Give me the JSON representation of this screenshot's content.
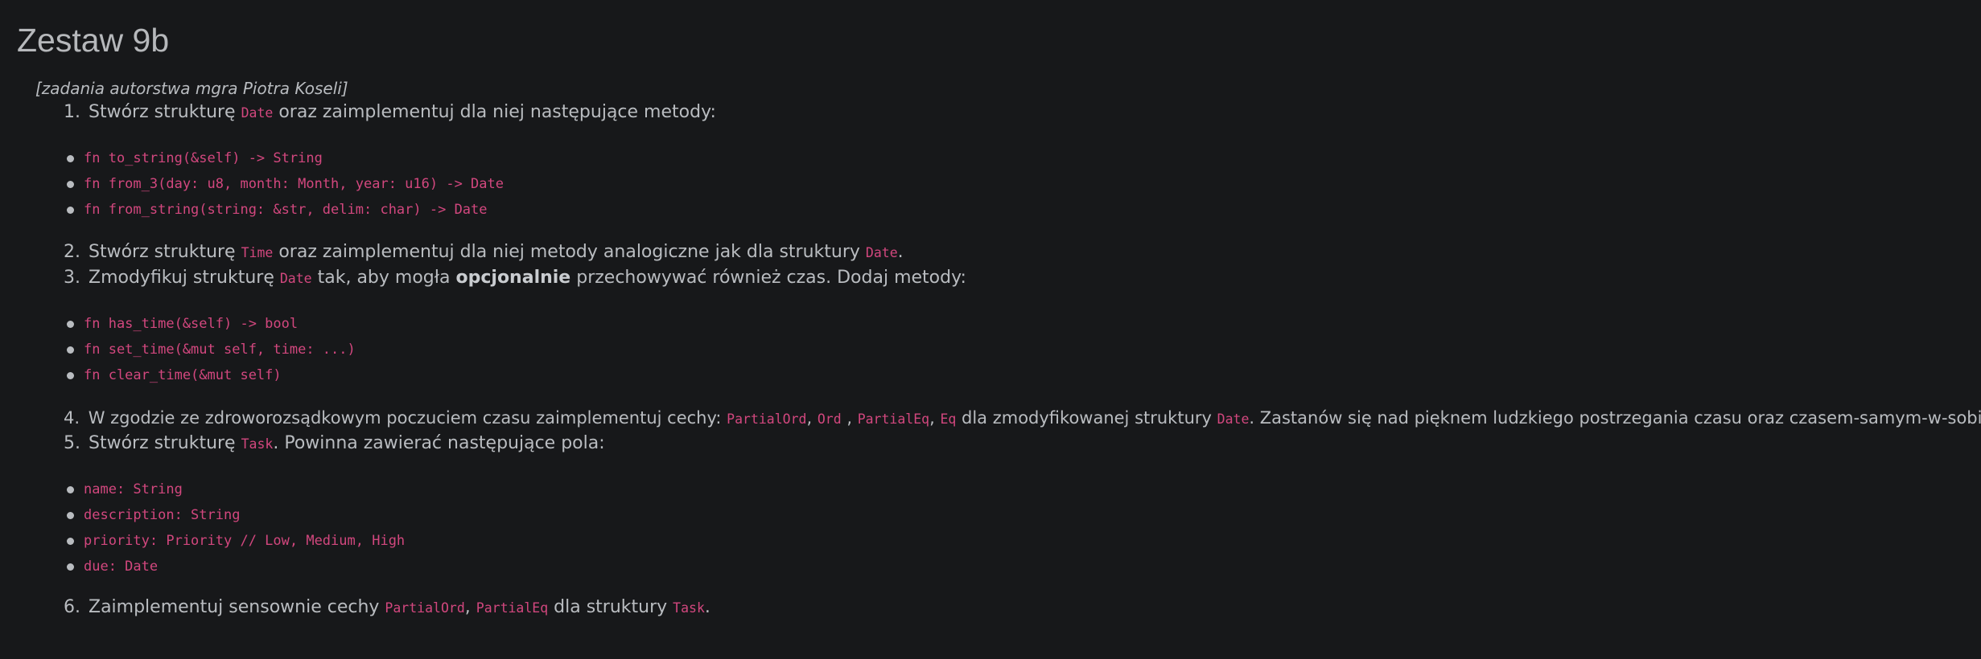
{
  "title": "Zestaw 9b",
  "credit": "[zadania autorstwa mgra Piotra Koseli]",
  "task1": {
    "num": "1.",
    "a": "Stwórz strukturę ",
    "code1": "Date",
    "b": " oraz zaimplementuj dla niej następujące metody:",
    "items": [
      "fn to_string(&self) -> String",
      "fn from_3(day: u8, month: Month, year: u16) -> Date",
      "fn from_string(string: &str, delim: char) -> Date"
    ]
  },
  "task2": {
    "num": "2.",
    "a": "Stwórz strukturę ",
    "code1": "Time",
    "b": " oraz zaimplementuj dla niej metody analogiczne jak dla struktury ",
    "code2": "Date",
    "c": "."
  },
  "task3": {
    "num": "3.",
    "a": "Zmodyfikuj strukturę ",
    "code1": "Date",
    "b": " tak, aby mogła ",
    "bold": "opcjonalnie",
    "c": " przechowywać również czas. Dodaj metody:",
    "items": [
      "fn has_time(&self) -> bool",
      "fn set_time(&mut self, time: ...)",
      "fn clear_time(&mut self)"
    ]
  },
  "task4": {
    "num": "4.",
    "a": "W zgodzie ze zdroworozsądkowym poczuciem czasu zaimplementuj cechy: ",
    "code1": "PartialOrd",
    "s1": ", ",
    "code2": "Ord",
    "s2": " , ",
    "code3": "PartialEq",
    "s3": ", ",
    "code4": "Eq",
    "b": " dla zmodyfikowanej struktury ",
    "code5": "Date",
    "c": ". Zastanów się nad pięknem ludzkiego postrzegania czasu oraz czasem-samym-w-sobie ;)"
  },
  "task5": {
    "num": "5.",
    "a": "Stwórz strukturę ",
    "code1": "Task",
    "b": ". Powinna zawierać następujące pola:",
    "items": [
      "name: String",
      "description: String",
      "priority: Priority // Low, Medium, High",
      "due: Date"
    ]
  },
  "task6": {
    "num": "6.",
    "a": "Zaimplementuj sensownie cechy ",
    "code1": "PartialOrd",
    "s1": ", ",
    "code2": "PartialEq",
    "b": " dla struktury ",
    "code3": "Task",
    "c": "."
  }
}
